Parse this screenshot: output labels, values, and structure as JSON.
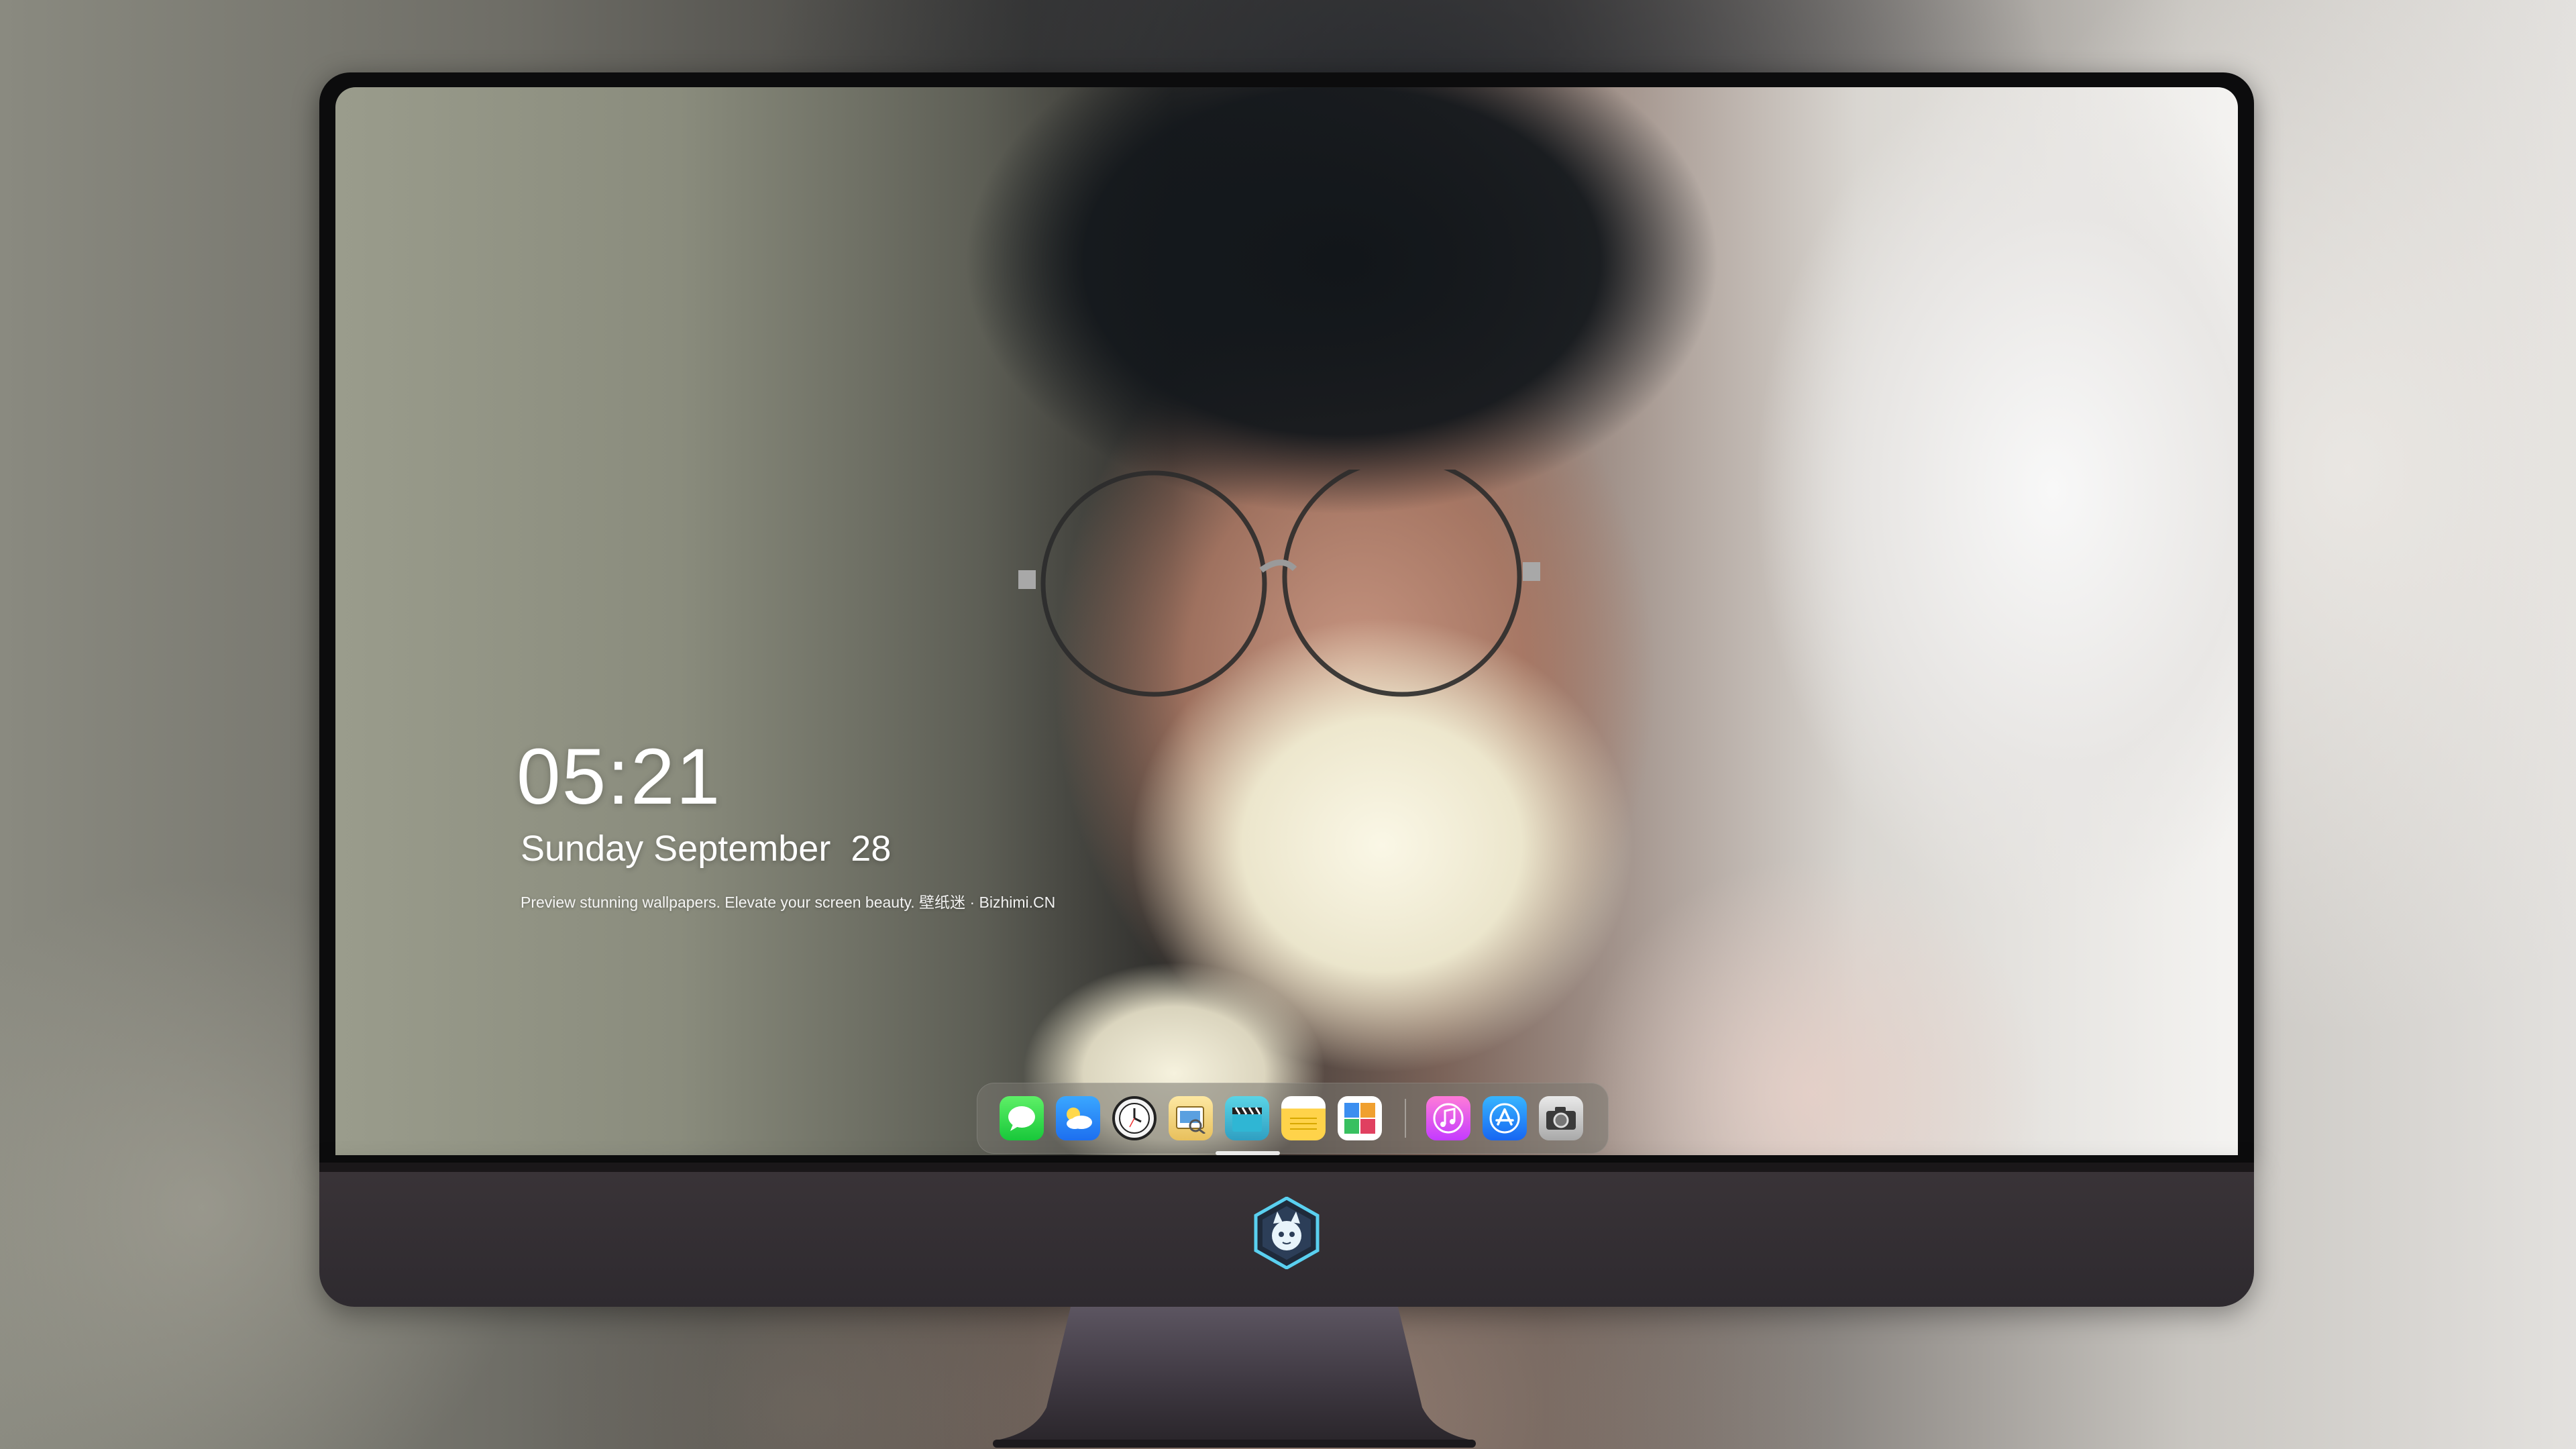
{
  "lockscreen": {
    "time": "05:21",
    "date": "Sunday September  28",
    "caption": "Preview stunning wallpapers. Elevate your screen beauty. 壁纸迷 · Bizhimi.CN"
  },
  "dock": {
    "apps": [
      {
        "name": "messages",
        "icon": "messages-icon"
      },
      {
        "name": "weather",
        "icon": "weather-icon"
      },
      {
        "name": "clock",
        "icon": "clock-icon"
      },
      {
        "name": "preview",
        "icon": "preview-icon"
      },
      {
        "name": "claquette",
        "icon": "clapperboard-icon"
      },
      {
        "name": "notes",
        "icon": "notes-icon"
      },
      {
        "name": "photos",
        "icon": "photo-collage-icon"
      },
      {
        "name": "music",
        "icon": "music-icon"
      },
      {
        "name": "app-store",
        "icon": "app-store-icon"
      },
      {
        "name": "camera",
        "icon": "camera-icon"
      }
    ]
  },
  "colors": {
    "bezel": "#0c0c0d",
    "chin": "#3a3438",
    "dock": "#78766f",
    "text": "#ffffff"
  },
  "logo": {
    "icon": "cat-mascot-logo"
  }
}
